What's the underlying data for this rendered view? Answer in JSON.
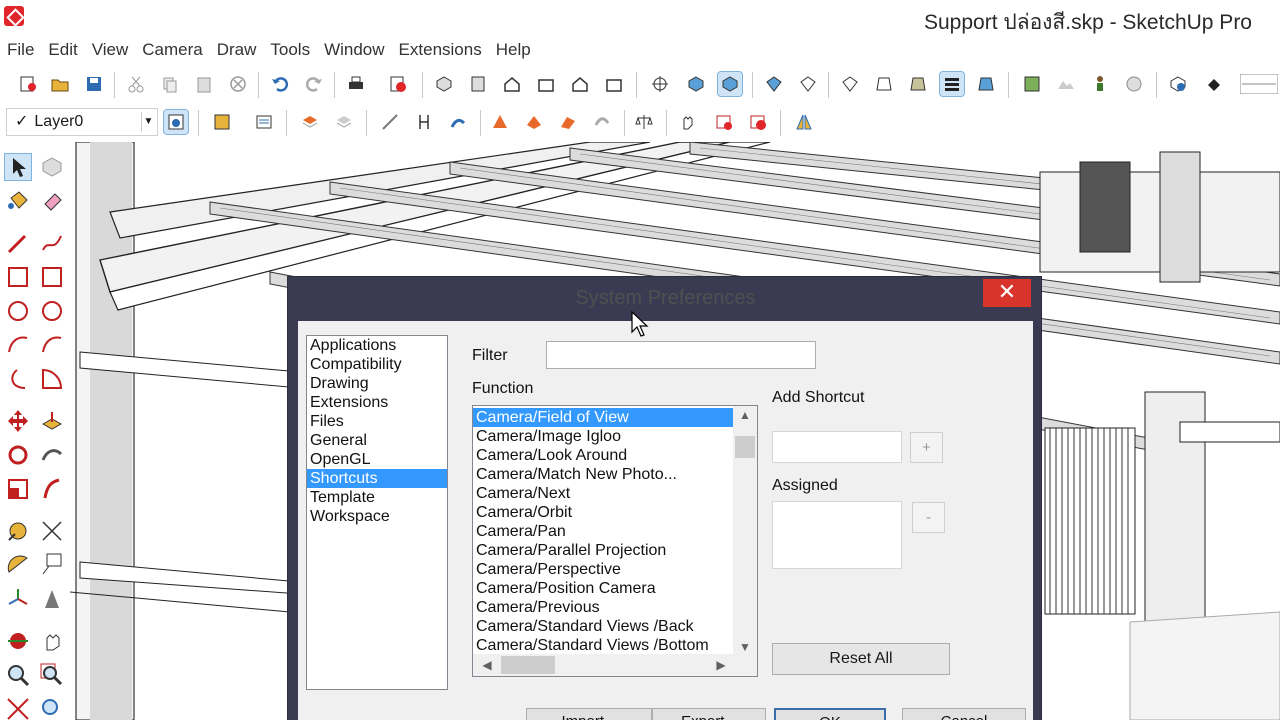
{
  "window": {
    "title": "Support ปล่องสี.skp - SketchUp Pro"
  },
  "menu": [
    "File",
    "Edit",
    "View",
    "Camera",
    "Draw",
    "Tools",
    "Window",
    "Extensions",
    "Help"
  ],
  "layer_toolbar": {
    "checkmark": "✓",
    "current_layer": "Layer0",
    "dropdown_arrow": "▼"
  },
  "dialog": {
    "title": "System Preferences",
    "close_glyph": "✕",
    "categories": [
      "Applications",
      "Compatibility",
      "Drawing",
      "Extensions",
      "Files",
      "General",
      "OpenGL",
      "Shortcuts",
      "Template",
      "Workspace"
    ],
    "selected_category": "Shortcuts",
    "filter_label": "Filter",
    "filter_value": "",
    "function_label": "Function",
    "functions": [
      "Camera/Field of View",
      "Camera/Image Igloo",
      "Camera/Look Around",
      "Camera/Match New Photo...",
      "Camera/Next",
      "Camera/Orbit",
      "Camera/Pan",
      "Camera/Parallel Projection",
      "Camera/Perspective",
      "Camera/Position Camera",
      "Camera/Previous",
      "Camera/Standard Views /Back",
      "Camera/Standard Views /Bottom"
    ],
    "selected_function": "Camera/Field of View",
    "add_shortcut_label": "Add Shortcut",
    "add_shortcut_value": "",
    "add_button": "+",
    "assigned_label": "Assigned",
    "remove_button": "-",
    "reset_all_button": "Reset All",
    "bottom_buttons": [
      "Import...",
      "Export...",
      "OK",
      "Cancel"
    ]
  },
  "colors": {
    "selection": "#3399ff",
    "close_button": "#d9342b",
    "dialog_frame": "#3a3a52",
    "sketchup_red": "#e0262b"
  }
}
